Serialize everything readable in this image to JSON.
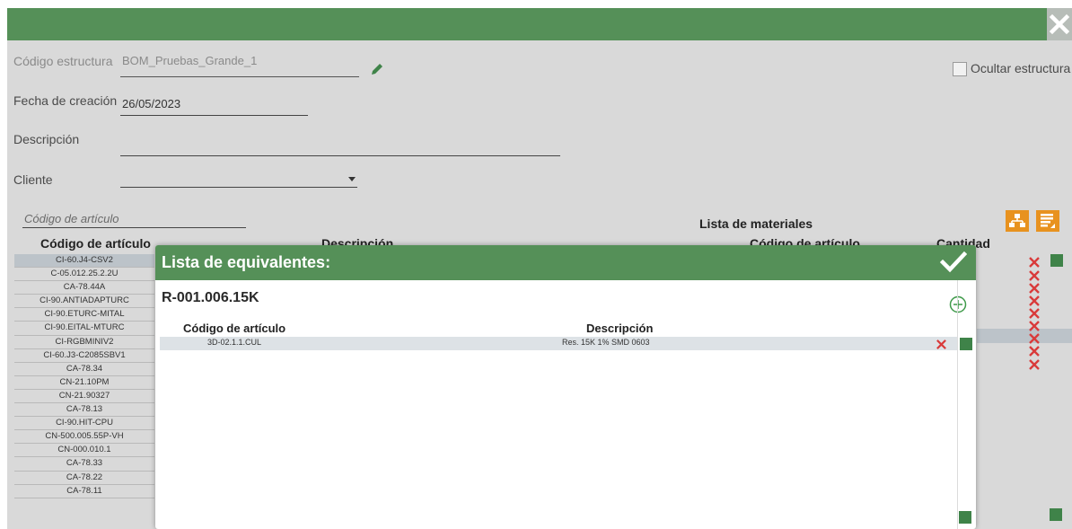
{
  "form": {
    "code_label": "Código estructura",
    "code_value": "BOM_Pruebas_Grande_1",
    "date_label": "Fecha de creación",
    "date_value": "26/05/2023",
    "desc_label": "Descripción",
    "desc_value": "",
    "client_label": "Cliente",
    "client_value": "",
    "hide_label": "Ocultar estructura"
  },
  "search": {
    "placeholder": "Código de artículo"
  },
  "left_list": {
    "header": "Código de artículo",
    "items": [
      "CI-60.J4-CSV2",
      "C-05.012.25.2.2U",
      "CA-78.44A",
      "CI-90.ANTIADAPTURC",
      "CI-90.ETURC-MITAL",
      "CI-90.EITAL-MTURC",
      "CI-RGBMINIV2",
      "CI-60.J3-C2085SBV1",
      "CA-78.34",
      "CN-21.10PM",
      "CN-21.90327",
      "CA-78.13",
      "CI-90.HIT-CPU",
      "CN-500.005.55P-VH",
      "CN-000.010.1",
      "CA-78.33",
      "CA-78.22",
      "CA-78.11"
    ]
  },
  "middle": {
    "description_header": "Descripción"
  },
  "materials": {
    "title": "Lista de materiales",
    "code_header": "Código de artículo",
    "qty_header": "Cantidad"
  },
  "modal": {
    "title": "Lista de equivalentes:",
    "code": "R-001.006.15K",
    "col_code": "Código de artículo",
    "col_desc": "Descripción",
    "rows": [
      {
        "code": "3D-02.1.1.CUL",
        "desc": "Res. 15K 1% SMD 0603"
      }
    ]
  },
  "colors": {
    "header_green": "#559058",
    "button_orange": "#e8921f",
    "delete_red": "#d93a3a",
    "square_green": "#3f8349"
  }
}
